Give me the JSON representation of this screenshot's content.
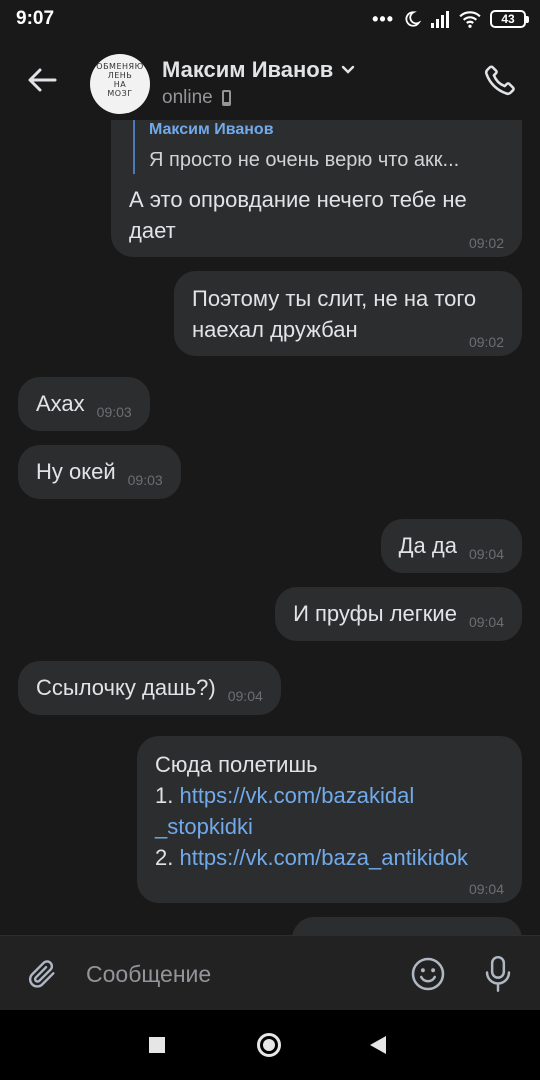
{
  "status_bar": {
    "time": "9:07",
    "battery": "43",
    "icons": [
      "more-dots-icon",
      "do-not-disturb-moon-icon",
      "cell-signal-icon",
      "wifi-icon",
      "battery-icon"
    ]
  },
  "header": {
    "contact_name": "Максим Иванов",
    "status": "online",
    "avatar_text": [
      "ОБМЕНЯЮ",
      "ЛЕНЬ",
      "НА",
      "МОЗГ"
    ],
    "icons": [
      "back-arrow-icon",
      "chevron-down-icon",
      "phone-device-icon",
      "phone-call-icon"
    ]
  },
  "messages": [
    {
      "direction": "out",
      "reply": {
        "author": "Максим Иванов",
        "text": "Я просто не очень верю что акк..."
      },
      "lines": [
        "А это опровдание нечего тебе не",
        "дает"
      ],
      "time": "09:02"
    },
    {
      "direction": "out",
      "lines": [
        "Поэтому ты слит, не на того",
        "наехал дружбан"
      ],
      "time": "09:02"
    },
    {
      "direction": "in",
      "text": "Ахах",
      "time": "09:03"
    },
    {
      "direction": "in",
      "text": "Ну окей",
      "time": "09:03"
    },
    {
      "direction": "out",
      "text": "Да да",
      "time": "09:04"
    },
    {
      "direction": "out",
      "text": "И пруфы легкие",
      "time": "09:04"
    },
    {
      "direction": "in",
      "text": "Ссылочку дашь?)",
      "time": "09:04"
    },
    {
      "direction": "out",
      "intro": "Сюда полетишь",
      "item1_prefix": "1. ",
      "item1_link_a": "https://vk.com/bazakidal",
      "item1_link_b": "_stopkidki",
      "item2_prefix": "2. ",
      "item2_link": "https://vk.com/baza_antikidok",
      "time": "09:04"
    }
  ],
  "input": {
    "placeholder": "Сообщение",
    "icons": [
      "paperclip-icon",
      "emoji-smile-icon",
      "microphone-icon"
    ]
  },
  "nav_bar": {
    "icons": [
      "recent-apps-icon",
      "home-icon",
      "back-icon"
    ]
  },
  "colors": {
    "background": "#19191a",
    "bubble": "#2c2d2e",
    "link": "#71aaeb",
    "text": "#e1e3e6",
    "secondary_text": "#939599"
  }
}
